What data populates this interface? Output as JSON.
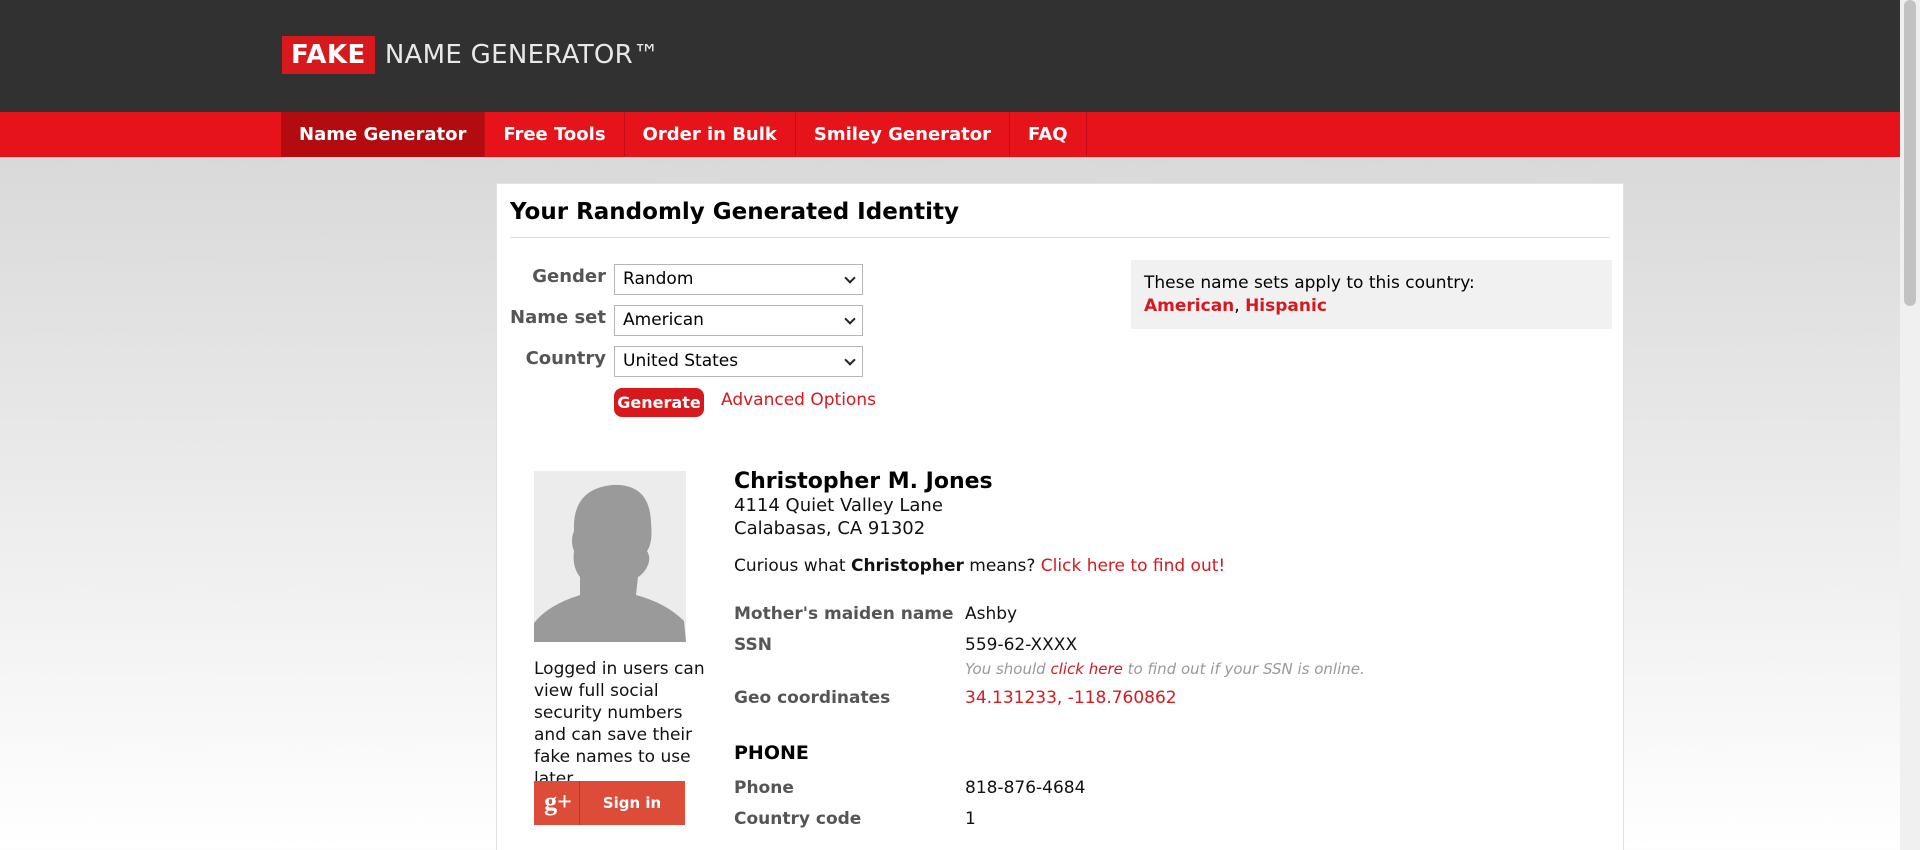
{
  "header": {
    "logo_fake": "FAKE",
    "logo_rest": "NAME GENERATOR™"
  },
  "nav": {
    "items": [
      {
        "label": "Name Generator"
      },
      {
        "label": "Free Tools"
      },
      {
        "label": "Order in Bulk"
      },
      {
        "label": "Smiley Generator"
      },
      {
        "label": "FAQ"
      }
    ],
    "active": "Name Generator"
  },
  "panel": {
    "title": "Your Randomly Generated Identity",
    "form": {
      "gender_label": "Gender",
      "gender_value": "Random",
      "nameset_label": "Name set",
      "nameset_value": "American",
      "country_label": "Country",
      "country_value": "United States",
      "generate_label": "Generate",
      "advanced_label": "Advanced Options"
    },
    "info": {
      "text": "These name sets apply to this country:",
      "set1": "American",
      "separator": ", ",
      "set2": "Hispanic"
    }
  },
  "identity": {
    "name": "Christopher M. Jones",
    "address_line1": "4114 Quiet Valley Lane",
    "address_line2": "Calabasas, CA 91302",
    "curious_prefix": "Curious what ",
    "curious_name": "Christopher",
    "curious_suffix": " means? ",
    "curious_link": "Click here to find out!",
    "maiden_label": "Mother's maiden name",
    "maiden_value": "Ashby",
    "ssn_label": "SSN",
    "ssn_value": "559-62-XXXX",
    "ssn_note_prefix": "You should ",
    "ssn_note_link": "click here",
    "ssn_note_suffix": " to find out if your SSN is online.",
    "geo_label": "Geo coordinates",
    "geo_value": "34.131233, -118.760862",
    "phone_section": "PHONE",
    "phone_label": "Phone",
    "phone_value": "818-876-4684",
    "cc_label": "Country code",
    "cc_value": "1"
  },
  "sidebar": {
    "login_text": "Logged in users can view full social security numbers and can save their fake names to use later.",
    "gplus_icon": "g+",
    "signin_label": "Sign in"
  },
  "colors": {
    "brand_red": "#d7191e",
    "nav_red": "#e6131b",
    "header_dark": "#313131"
  }
}
